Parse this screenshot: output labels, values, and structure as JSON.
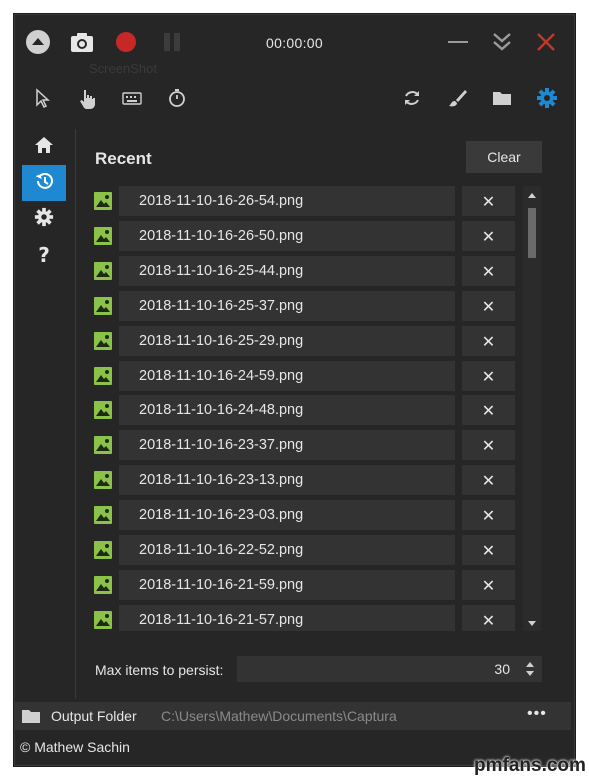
{
  "titlebar": {
    "timer": "00:00:00",
    "ghost_label": "ScreenShot"
  },
  "recent": {
    "title": "Recent",
    "clear_label": "Clear",
    "items": [
      "2018-11-10-16-26-54.png",
      "2018-11-10-16-26-50.png",
      "2018-11-10-16-25-44.png",
      "2018-11-10-16-25-37.png",
      "2018-11-10-16-25-29.png",
      "2018-11-10-16-24-59.png",
      "2018-11-10-16-24-48.png",
      "2018-11-10-16-23-37.png",
      "2018-11-10-16-23-13.png",
      "2018-11-10-16-23-03.png",
      "2018-11-10-16-22-52.png",
      "2018-11-10-16-21-59.png",
      "2018-11-10-16-21-57.png"
    ],
    "delete_glyph": "✕"
  },
  "persist": {
    "label": "Max items to persist:",
    "value": "30"
  },
  "output": {
    "label": "Output Folder",
    "path": "C:\\Users\\Mathew\\Documents\\Captura",
    "more": "•••"
  },
  "footer": {
    "copyright": "© Mathew Sachin"
  },
  "watermark": "pmfans.com",
  "colors": {
    "accent": "#1e88d0",
    "record": "#c62828",
    "image_icon": "#8bc34a",
    "close_hover": "#c0392b"
  },
  "icons": {
    "top": [
      "collapse-icon",
      "camera-icon",
      "record-icon",
      "pause-icon",
      "minimize-icon",
      "expand-down-icon",
      "close-icon"
    ],
    "toolbar": [
      "cursor-icon",
      "hand-icon",
      "keyboard-icon",
      "stopwatch-icon",
      "refresh-icon",
      "brush-icon",
      "folder-icon",
      "gear-icon"
    ],
    "nav": [
      "home-icon",
      "history-icon",
      "settings-icon",
      "help-icon"
    ]
  }
}
